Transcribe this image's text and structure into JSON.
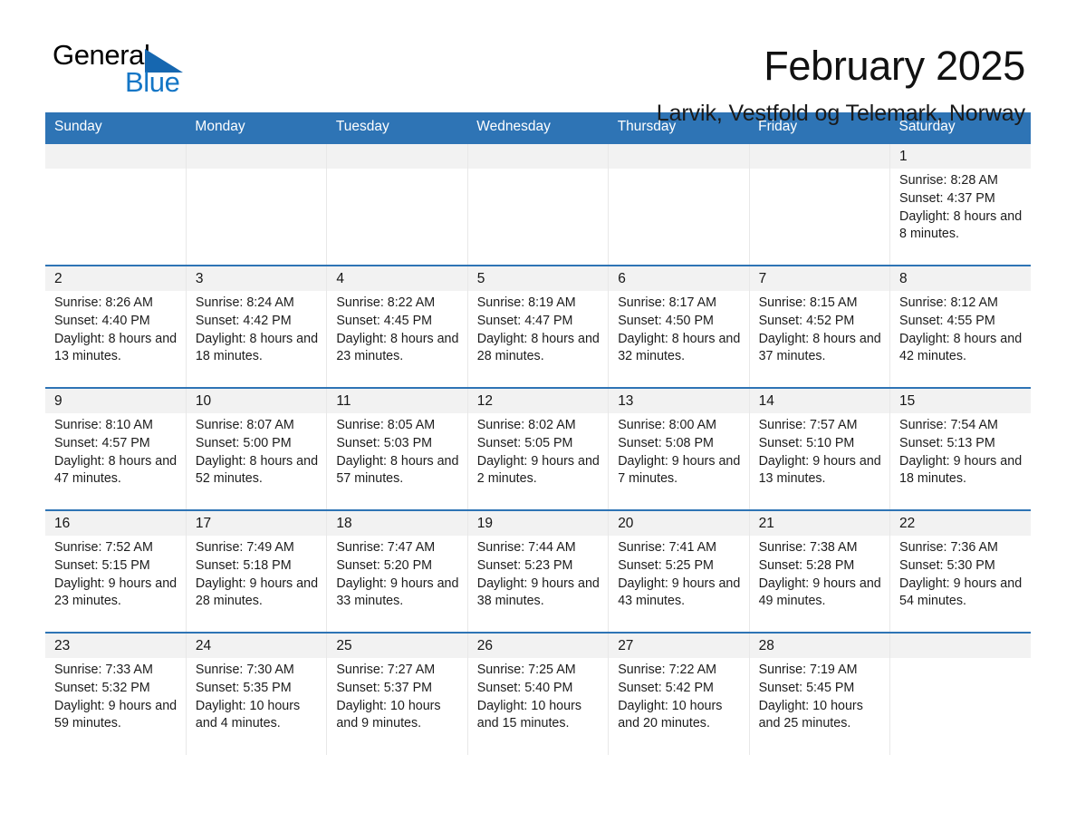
{
  "brand": {
    "name_part1": "General",
    "name_part2": "Blue",
    "triangle_color": "#1667b0",
    "blue_color": "#1476c6"
  },
  "header": {
    "month_title": "February 2025",
    "location": "Larvik, Vestfold og Telemark, Norway"
  },
  "theme": {
    "header_blue": "#2e74b5",
    "daynum_band": "#f2f2f2",
    "text": "#1a1a1a"
  },
  "weekdays": [
    "Sunday",
    "Monday",
    "Tuesday",
    "Wednesday",
    "Thursday",
    "Friday",
    "Saturday"
  ],
  "labels": {
    "sunrise_prefix": "Sunrise:",
    "sunset_prefix": "Sunset:",
    "daylight_prefix": "Daylight:"
  },
  "weeks": [
    [
      {
        "day": "",
        "empty": true
      },
      {
        "day": "",
        "empty": true
      },
      {
        "day": "",
        "empty": true
      },
      {
        "day": "",
        "empty": true
      },
      {
        "day": "",
        "empty": true
      },
      {
        "day": "",
        "empty": true
      },
      {
        "day": "1",
        "sunrise": "Sunrise: 8:28 AM",
        "sunset": "Sunset: 4:37 PM",
        "daylight": "Daylight: 8 hours and 8 minutes."
      }
    ],
    [
      {
        "day": "2",
        "sunrise": "Sunrise: 8:26 AM",
        "sunset": "Sunset: 4:40 PM",
        "daylight": "Daylight: 8 hours and 13 minutes."
      },
      {
        "day": "3",
        "sunrise": "Sunrise: 8:24 AM",
        "sunset": "Sunset: 4:42 PM",
        "daylight": "Daylight: 8 hours and 18 minutes."
      },
      {
        "day": "4",
        "sunrise": "Sunrise: 8:22 AM",
        "sunset": "Sunset: 4:45 PM",
        "daylight": "Daylight: 8 hours and 23 minutes."
      },
      {
        "day": "5",
        "sunrise": "Sunrise: 8:19 AM",
        "sunset": "Sunset: 4:47 PM",
        "daylight": "Daylight: 8 hours and 28 minutes."
      },
      {
        "day": "6",
        "sunrise": "Sunrise: 8:17 AM",
        "sunset": "Sunset: 4:50 PM",
        "daylight": "Daylight: 8 hours and 32 minutes."
      },
      {
        "day": "7",
        "sunrise": "Sunrise: 8:15 AM",
        "sunset": "Sunset: 4:52 PM",
        "daylight": "Daylight: 8 hours and 37 minutes."
      },
      {
        "day": "8",
        "sunrise": "Sunrise: 8:12 AM",
        "sunset": "Sunset: 4:55 PM",
        "daylight": "Daylight: 8 hours and 42 minutes."
      }
    ],
    [
      {
        "day": "9",
        "sunrise": "Sunrise: 8:10 AM",
        "sunset": "Sunset: 4:57 PM",
        "daylight": "Daylight: 8 hours and 47 minutes."
      },
      {
        "day": "10",
        "sunrise": "Sunrise: 8:07 AM",
        "sunset": "Sunset: 5:00 PM",
        "daylight": "Daylight: 8 hours and 52 minutes."
      },
      {
        "day": "11",
        "sunrise": "Sunrise: 8:05 AM",
        "sunset": "Sunset: 5:03 PM",
        "daylight": "Daylight: 8 hours and 57 minutes."
      },
      {
        "day": "12",
        "sunrise": "Sunrise: 8:02 AM",
        "sunset": "Sunset: 5:05 PM",
        "daylight": "Daylight: 9 hours and 2 minutes."
      },
      {
        "day": "13",
        "sunrise": "Sunrise: 8:00 AM",
        "sunset": "Sunset: 5:08 PM",
        "daylight": "Daylight: 9 hours and 7 minutes."
      },
      {
        "day": "14",
        "sunrise": "Sunrise: 7:57 AM",
        "sunset": "Sunset: 5:10 PM",
        "daylight": "Daylight: 9 hours and 13 minutes."
      },
      {
        "day": "15",
        "sunrise": "Sunrise: 7:54 AM",
        "sunset": "Sunset: 5:13 PM",
        "daylight": "Daylight: 9 hours and 18 minutes."
      }
    ],
    [
      {
        "day": "16",
        "sunrise": "Sunrise: 7:52 AM",
        "sunset": "Sunset: 5:15 PM",
        "daylight": "Daylight: 9 hours and 23 minutes."
      },
      {
        "day": "17",
        "sunrise": "Sunrise: 7:49 AM",
        "sunset": "Sunset: 5:18 PM",
        "daylight": "Daylight: 9 hours and 28 minutes."
      },
      {
        "day": "18",
        "sunrise": "Sunrise: 7:47 AM",
        "sunset": "Sunset: 5:20 PM",
        "daylight": "Daylight: 9 hours and 33 minutes."
      },
      {
        "day": "19",
        "sunrise": "Sunrise: 7:44 AM",
        "sunset": "Sunset: 5:23 PM",
        "daylight": "Daylight: 9 hours and 38 minutes."
      },
      {
        "day": "20",
        "sunrise": "Sunrise: 7:41 AM",
        "sunset": "Sunset: 5:25 PM",
        "daylight": "Daylight: 9 hours and 43 minutes."
      },
      {
        "day": "21",
        "sunrise": "Sunrise: 7:38 AM",
        "sunset": "Sunset: 5:28 PM",
        "daylight": "Daylight: 9 hours and 49 minutes."
      },
      {
        "day": "22",
        "sunrise": "Sunrise: 7:36 AM",
        "sunset": "Sunset: 5:30 PM",
        "daylight": "Daylight: 9 hours and 54 minutes."
      }
    ],
    [
      {
        "day": "23",
        "sunrise": "Sunrise: 7:33 AM",
        "sunset": "Sunset: 5:32 PM",
        "daylight": "Daylight: 9 hours and 59 minutes."
      },
      {
        "day": "24",
        "sunrise": "Sunrise: 7:30 AM",
        "sunset": "Sunset: 5:35 PM",
        "daylight": "Daylight: 10 hours and 4 minutes."
      },
      {
        "day": "25",
        "sunrise": "Sunrise: 7:27 AM",
        "sunset": "Sunset: 5:37 PM",
        "daylight": "Daylight: 10 hours and 9 minutes."
      },
      {
        "day": "26",
        "sunrise": "Sunrise: 7:25 AM",
        "sunset": "Sunset: 5:40 PM",
        "daylight": "Daylight: 10 hours and 15 minutes."
      },
      {
        "day": "27",
        "sunrise": "Sunrise: 7:22 AM",
        "sunset": "Sunset: 5:42 PM",
        "daylight": "Daylight: 10 hours and 20 minutes."
      },
      {
        "day": "28",
        "sunrise": "Sunrise: 7:19 AM",
        "sunset": "Sunset: 5:45 PM",
        "daylight": "Daylight: 10 hours and 25 minutes."
      },
      {
        "day": "",
        "empty": true
      }
    ]
  ]
}
